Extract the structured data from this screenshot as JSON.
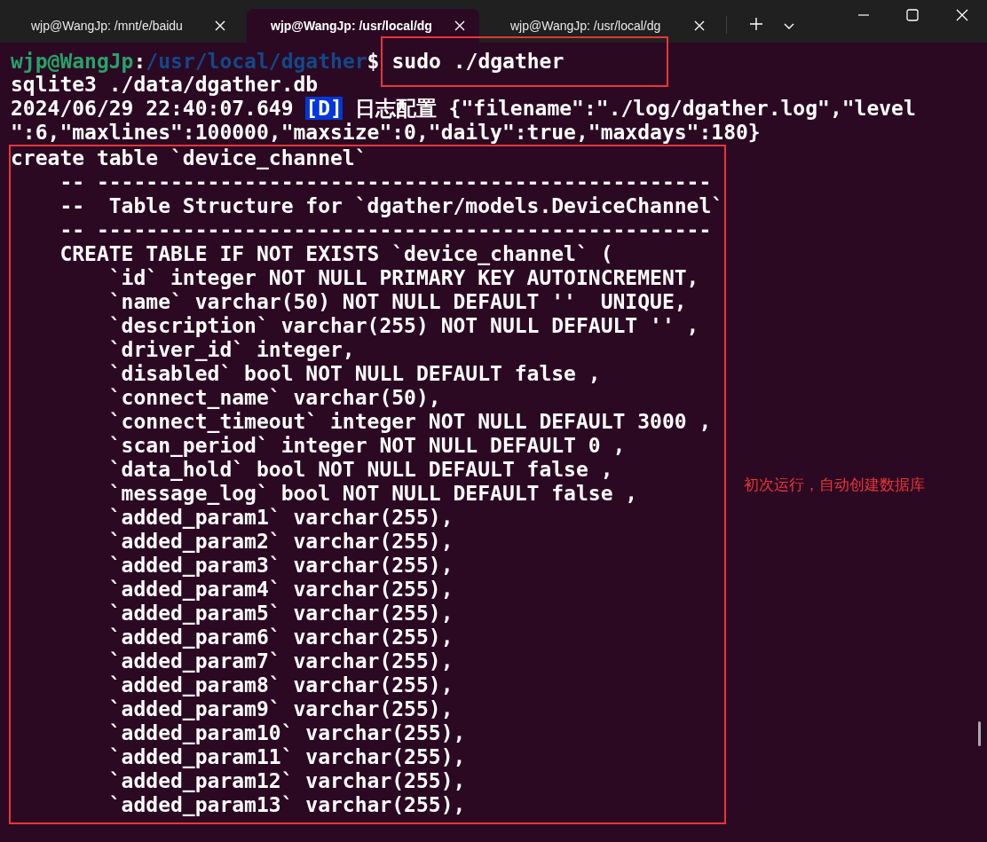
{
  "tabs": [
    {
      "title": "wjp@WangJp: /mnt/e/baidu",
      "selected": false
    },
    {
      "title": "wjp@WangJp: /usr/local/dg",
      "selected": true
    },
    {
      "title": "wjp@WangJp: /usr/local/dg",
      "selected": false
    }
  ],
  "terminal": {
    "prompt": {
      "user": "wjp@WangJp",
      "separator": ":",
      "path": "/usr/local/dgather",
      "symbol": "$",
      "command": "sudo ./dgather",
      "highlighted": true
    },
    "output": [
      {
        "kind": "text",
        "text": "sqlite3 ./data/dgather.db"
      },
      {
        "kind": "log",
        "time": "2024/06/29 22:40:07.649",
        "level": "[D]",
        "message": "日志配置 {\"filename\":\"./log/dgather.log\",\"level"
      },
      {
        "kind": "text",
        "text": "\":6,\"maxlines\":100000,\"maxsize\":0,\"daily\":true,\"maxdays\":180}"
      }
    ],
    "highlighted_block": {
      "lines": [
        "create table `device_channel`",
        "    -- --------------------------------------------------",
        "    --  Table Structure for `dgather/models.DeviceChannel`",
        "    -- --------------------------------------------------",
        "    CREATE TABLE IF NOT EXISTS `device_channel` (",
        "        `id` integer NOT NULL PRIMARY KEY AUTOINCREMENT,",
        "        `name` varchar(50) NOT NULL DEFAULT ''  UNIQUE,",
        "        `description` varchar(255) NOT NULL DEFAULT '' ,",
        "        `driver_id` integer,",
        "        `disabled` bool NOT NULL DEFAULT false ,",
        "        `connect_name` varchar(50),",
        "        `connect_timeout` integer NOT NULL DEFAULT 3000 ,",
        "        `scan_period` integer NOT NULL DEFAULT 0 ,",
        "        `data_hold` bool NOT NULL DEFAULT false ,",
        "        `message_log` bool NOT NULL DEFAULT false ,",
        "        `added_param1` varchar(255),",
        "        `added_param2` varchar(255),",
        "        `added_param3` varchar(255),",
        "        `added_param4` varchar(255),",
        "        `added_param5` varchar(255),",
        "        `added_param6` varchar(255),",
        "        `added_param7` varchar(255),",
        "        `added_param8` varchar(255),",
        "        `added_param9` varchar(255),",
        "        `added_param10` varchar(255),",
        "        `added_param11` varchar(255),",
        "        `added_param12` varchar(255),",
        "        `added_param13` varchar(255),"
      ],
      "note": "初次运行，自动创建数据库"
    }
  }
}
